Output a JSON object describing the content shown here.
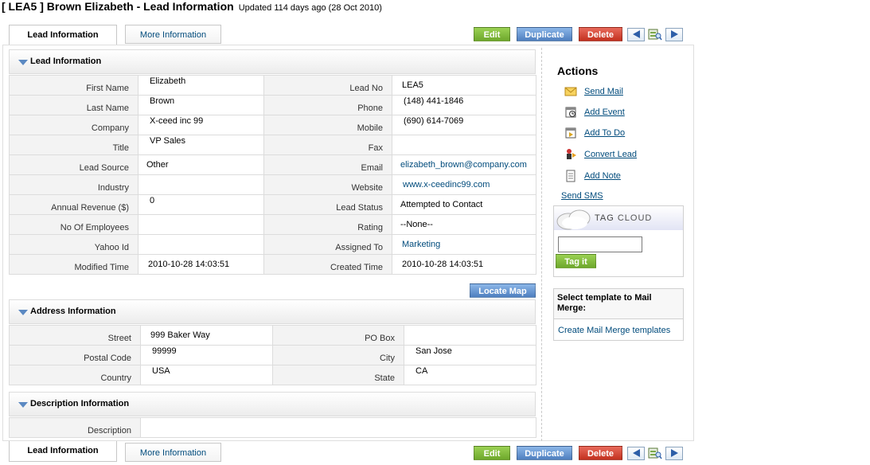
{
  "header": {
    "title": "[ LEA5 ] Brown Elizabeth - Lead Information",
    "updated": "Updated 114 days ago (28 Oct 2010)"
  },
  "tabs": {
    "lead_info": "Lead Information",
    "more_info": "More Information"
  },
  "toolbar": {
    "edit": "Edit",
    "duplicate": "Duplicate",
    "delete": "Delete"
  },
  "lead_section": {
    "title": "Lead Information",
    "rows": [
      {
        "l1": "First Name",
        "v1": "Elizabeth",
        "l2": "Lead No",
        "v2": "LEA5"
      },
      {
        "l1": "Last Name",
        "v1": "Brown",
        "l2": "Phone",
        "v2": "(148) 441-1846"
      },
      {
        "l1": "Company",
        "v1": "X-ceed inc 99",
        "l2": "Mobile",
        "v2": "(690) 614-7069"
      },
      {
        "l1": "Title",
        "v1": "VP Sales",
        "l2": "Fax",
        "v2": ""
      },
      {
        "l1": "Lead Source",
        "v1": "Other",
        "l2": "Email",
        "v2": "elizabeth_brown@company.com"
      },
      {
        "l1": "Industry",
        "v1": "",
        "l2": "Website",
        "v2": "www.x-ceedinc99.com"
      },
      {
        "l1": "Annual Revenue ($)",
        "v1": "0",
        "l2": "Lead Status",
        "v2": "Attempted to Contact"
      },
      {
        "l1": "No Of Employees",
        "v1": "",
        "l2": "Rating",
        "v2": "--None--"
      },
      {
        "l1": "Yahoo Id",
        "v1": "",
        "l2": "Assigned To",
        "v2": "Marketing"
      },
      {
        "l1": "Modified Time",
        "v1": "2010-10-28 14:03:51",
        "l2": "Created Time",
        "v2": "2010-10-28 14:03:51"
      }
    ]
  },
  "locate_map": "Locate Map",
  "address_section": {
    "title": "Address Information",
    "rows": [
      {
        "l1": "Street",
        "v1": "999 Baker Way",
        "l2": "PO Box",
        "v2": ""
      },
      {
        "l1": "Postal Code",
        "v1": "99999",
        "l2": "City",
        "v2": "San Jose"
      },
      {
        "l1": "Country",
        "v1": "USA",
        "l2": "State",
        "v2": "CA"
      }
    ]
  },
  "description_section": {
    "title": "Description Information",
    "label": "Description",
    "value": ""
  },
  "actions": {
    "title": "Actions",
    "items": [
      {
        "label": "Send Mail",
        "icon": "mail-icon"
      },
      {
        "label": "Add Event",
        "icon": "event-icon"
      },
      {
        "label": "Add To Do",
        "icon": "todo-icon"
      },
      {
        "label": "Convert Lead",
        "icon": "convert-lead-icon"
      },
      {
        "label": "Add Note",
        "icon": "note-icon"
      }
    ],
    "send_sms": "Send SMS"
  },
  "tag_cloud": {
    "tag": "TAG",
    "cloud": "CLOUD",
    "button": "Tag it",
    "input_value": ""
  },
  "mail_merge": {
    "heading": "Select template to Mail Merge:",
    "link": "Create Mail Merge templates"
  },
  "colors": {
    "link": "#004b7c",
    "edit": "#7fbb3c",
    "duplicate": "#5b8ccb",
    "delete": "#d5402d"
  }
}
